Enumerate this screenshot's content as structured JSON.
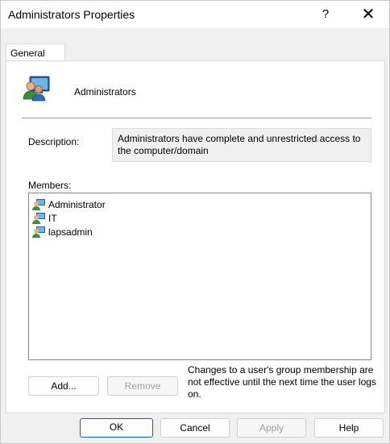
{
  "window": {
    "title": "Administrators Properties",
    "help_glyph": "?",
    "close_glyph": "✕"
  },
  "tabs": [
    {
      "label": "General",
      "selected": true
    }
  ],
  "general": {
    "group_name": "Administrators",
    "description_label": "Description:",
    "description_value": "Administrators have complete and unrestricted access to the computer/domain",
    "members_label": "Members:",
    "members": [
      {
        "name": "Administrator",
        "icon": "user-icon"
      },
      {
        "name": "IT",
        "icon": "user-icon"
      },
      {
        "name": "lapsadmin",
        "icon": "user-icon"
      }
    ],
    "add_label": "Add...",
    "remove_label": "Remove",
    "note": "Changes to a user's group membership are not effective until the next time the user logs on."
  },
  "footer": {
    "ok_label": "OK",
    "cancel_label": "Cancel",
    "apply_label": "Apply",
    "help_label": "Help"
  }
}
